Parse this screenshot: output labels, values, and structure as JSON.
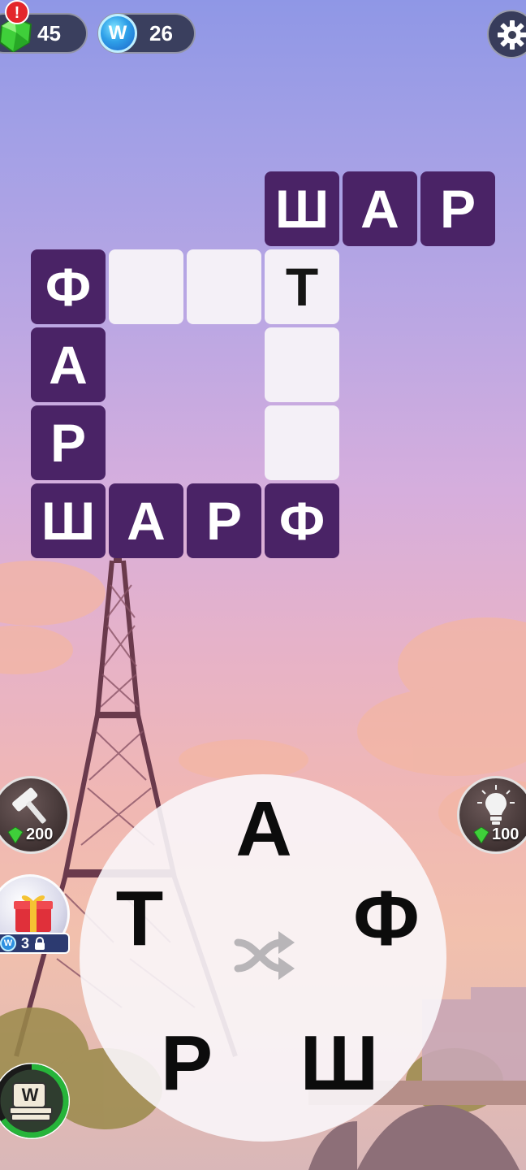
{
  "topbar": {
    "gems": "45",
    "coins": "26",
    "alert": "!",
    "coin_letter": "W"
  },
  "board": {
    "tiles": [
      {
        "row": 0,
        "col": 3,
        "letter": "Ш",
        "state": "filled"
      },
      {
        "row": 0,
        "col": 4,
        "letter": "А",
        "state": "filled"
      },
      {
        "row": 0,
        "col": 5,
        "letter": "Р",
        "state": "filled"
      },
      {
        "row": 1,
        "col": 0,
        "letter": "Ф",
        "state": "filled"
      },
      {
        "row": 1,
        "col": 1,
        "letter": "",
        "state": "empty"
      },
      {
        "row": 1,
        "col": 2,
        "letter": "",
        "state": "empty"
      },
      {
        "row": 1,
        "col": 3,
        "letter": "Т",
        "state": "hint"
      },
      {
        "row": 2,
        "col": 0,
        "letter": "А",
        "state": "filled"
      },
      {
        "row": 2,
        "col": 3,
        "letter": "",
        "state": "empty"
      },
      {
        "row": 3,
        "col": 0,
        "letter": "Р",
        "state": "filled"
      },
      {
        "row": 3,
        "col": 3,
        "letter": "",
        "state": "empty"
      },
      {
        "row": 4,
        "col": 0,
        "letter": "Ш",
        "state": "filled"
      },
      {
        "row": 4,
        "col": 1,
        "letter": "А",
        "state": "filled"
      },
      {
        "row": 4,
        "col": 2,
        "letter": "Р",
        "state": "filled"
      },
      {
        "row": 4,
        "col": 3,
        "letter": "Ф",
        "state": "filled"
      }
    ]
  },
  "boosters": {
    "hammer_cost": "200",
    "hint_cost": "100",
    "gift_count": "3",
    "gift_coin_letter": "W",
    "daily_letter": "W"
  },
  "wheel": {
    "letters": [
      {
        "key": "top",
        "letter": "А"
      },
      {
        "key": "left",
        "letter": "Т"
      },
      {
        "key": "right",
        "letter": "Ф"
      },
      {
        "key": "bottom-left",
        "letter": "Р"
      },
      {
        "key": "bottom-right",
        "letter": "Ш"
      }
    ]
  },
  "colors": {
    "tile_filled": "#4a2366",
    "tile_empty": "#f4f0f7",
    "gem_green": "#3fcf3a",
    "alert_red": "#e3262b",
    "coin_blue": "#2e9fe8"
  }
}
